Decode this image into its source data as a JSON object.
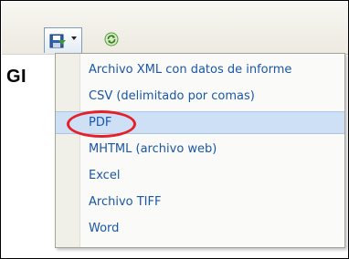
{
  "toolbar": {
    "export_icon": "save-disk-icon",
    "dropdown_icon": "chevron-down-icon",
    "refresh_icon": "refresh-icon"
  },
  "report": {
    "heading": "GI"
  },
  "export_menu": {
    "items": [
      {
        "label": "Archivo XML con datos de informe",
        "selected": false
      },
      {
        "label": "CSV (delimitado por comas)",
        "selected": false
      },
      {
        "label": "PDF",
        "selected": true
      },
      {
        "label": "MHTML (archivo web)",
        "selected": false
      },
      {
        "label": "Excel",
        "selected": false
      },
      {
        "label": "Archivo TIFF",
        "selected": false
      },
      {
        "label": "Word",
        "selected": false
      }
    ]
  },
  "annotation": {
    "ellipse_color": "#e5202a",
    "target": "PDF"
  },
  "colors": {
    "menu_text": "#1a56a8",
    "selected_bg": "#cde0f5"
  }
}
